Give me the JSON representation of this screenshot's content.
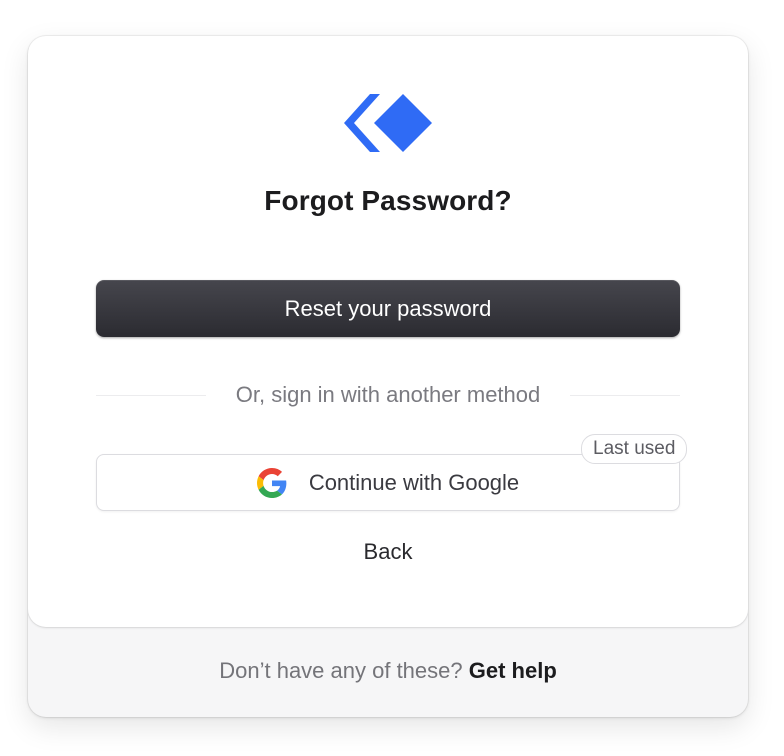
{
  "brand": {
    "logo_icon": "chevron-diamond-logo",
    "accent_color": "#2f6bf5"
  },
  "title": "Forgot Password?",
  "primary_button": {
    "label": "Reset your password"
  },
  "divider": {
    "text": "Or, sign in with another method"
  },
  "google_button": {
    "icon": "google-g-icon",
    "label": "Continue with Google",
    "badge": "Last used"
  },
  "back_link": {
    "label": "Back"
  },
  "footer": {
    "text": "Don’t have any of these?",
    "link_label": "Get help"
  }
}
